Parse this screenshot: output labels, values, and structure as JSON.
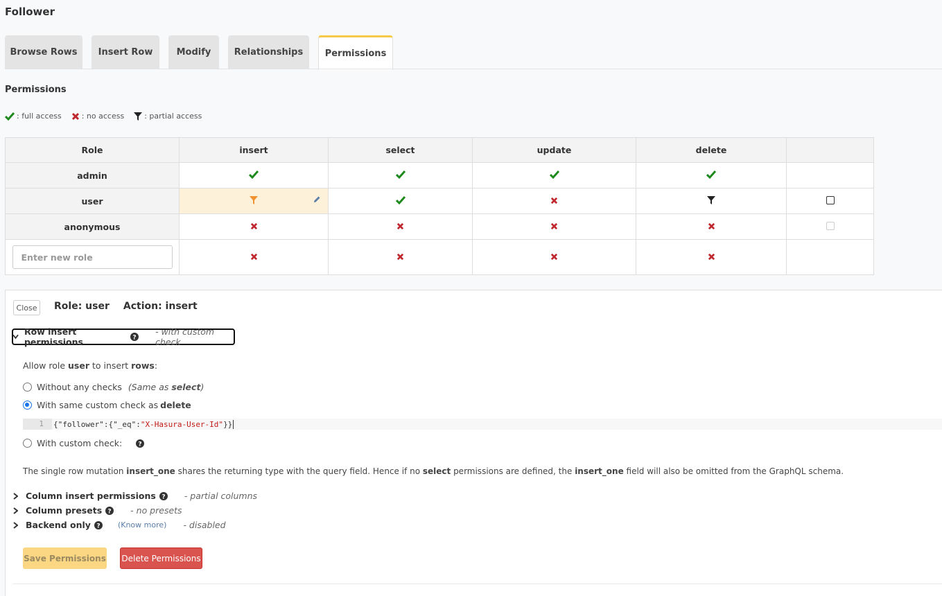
{
  "page": {
    "title": "Follower"
  },
  "tabs": [
    {
      "label": "Browse Rows",
      "active": false
    },
    {
      "label": "Insert Row",
      "active": false
    },
    {
      "label": "Modify",
      "active": false
    },
    {
      "label": "Relationships",
      "active": false
    },
    {
      "label": "Permissions",
      "active": true
    }
  ],
  "permissions": {
    "section_title": "Permissions",
    "legend": {
      "full": ": full access",
      "none": ": no access",
      "partial": ": partial access"
    },
    "headers": {
      "role": "Role",
      "insert": "insert",
      "select": "select",
      "update": "update",
      "delete": "delete"
    },
    "rows": [
      {
        "role": "admin",
        "insert": "full",
        "select": "full",
        "update": "full",
        "delete": "full"
      },
      {
        "role": "user",
        "insert": "partial",
        "select": "full",
        "update": "none",
        "delete": "partial"
      },
      {
        "role": "anonymous",
        "insert": "none",
        "select": "none",
        "update": "none",
        "delete": "none"
      }
    ],
    "new_role_placeholder": "Enter new role"
  },
  "panel": {
    "close_label": "Close",
    "role_heading": "Role: user",
    "action_heading": "Action: insert",
    "row_insert": {
      "title": "Row insert permissions",
      "hint": "- with custom check"
    },
    "allow_prefix": "Allow role ",
    "allow_role": "user",
    "allow_mid": " to insert ",
    "allow_target": "rows",
    "allow_suffix": ":",
    "option1_label": "Without any checks",
    "option1_note_prefix": "(Same as ",
    "option1_note_bold": "select",
    "option1_note_suffix": ")",
    "option2_label": "With same custom check as ",
    "option2_bold": "delete",
    "code_line_number": "1",
    "code_prefix": "{\"follower\":{\"_eq\":",
    "code_string": "\"X-Hasura-User-Id\"",
    "code_suffix": "}}",
    "option3_label": "With custom check:",
    "note_1": "The single row mutation ",
    "note_insert_one": "insert_one",
    "note_2": " shares the returning type with the query field. Hence if no ",
    "note_select": "select",
    "note_3": " permissions are defined, the ",
    "note_insert_one_2": "insert_one",
    "note_4": " field will also be omitted from the GraphQL schema.",
    "column_insert": {
      "title": "Column insert permissions",
      "hint": "- partial columns"
    },
    "column_presets": {
      "title": "Column presets",
      "hint": "- no presets"
    },
    "backend_only": {
      "title": "Backend only",
      "link": "(Know more)",
      "hint": "- disabled"
    },
    "save_label": "Save Permissions",
    "delete_label": "Delete Permissions"
  },
  "colors": {
    "full": "#1e8a1e",
    "none": "#c0272d",
    "partial_active": "#f0912f",
    "partial": "#222222",
    "tab_accent": "#f7c948"
  }
}
